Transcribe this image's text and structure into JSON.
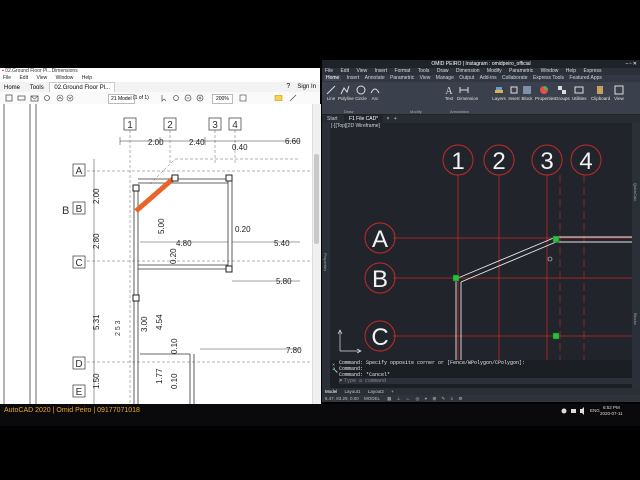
{
  "pdf": {
    "title": "02.Ground Floor Pl...Dimensions",
    "menu": [
      "File",
      "Edit",
      "View",
      "Window",
      "Help"
    ],
    "tabs": {
      "home": "Home",
      "tools": "Tools",
      "doc": "02.Ground Floor Pl..."
    },
    "sign_in": "Sign In",
    "page_field": "21 Model",
    "page_count": "(1 of 1)",
    "zoom": "200%",
    "axes": [
      "1",
      "2",
      "3",
      "4",
      "A",
      "B",
      "C",
      "D",
      "E"
    ],
    "dims": {
      "d200": "2.00",
      "d240": "2.40",
      "d040": "0.40",
      "d660": "6.60",
      "v200": "2.00",
      "v280": "2.80",
      "v531": "5.31",
      "v150": "1.50",
      "d500": "5.00",
      "d480": "4.80",
      "d020": "0.20",
      "d540": "5.40",
      "d580": "5.80",
      "d780": "7.80",
      "d300": "3.00",
      "d454": "4.54",
      "d010": "0.10",
      "d1770": "1.77",
      "d0100": "0.10",
      "d020b": "0.20"
    },
    "room_label": "2 5 3",
    "bay_mark": "B"
  },
  "cad": {
    "title": "OMID PEIRO | Instagram : omidpeiro_official",
    "menu": [
      "File",
      "Edit",
      "View",
      "Insert",
      "Format",
      "Tools",
      "Draw",
      "Dimension",
      "Modify",
      "Parametric",
      "Window",
      "Help",
      "Express"
    ],
    "ribbon_tabs": [
      "Home",
      "Insert",
      "Annotate",
      "Parametric",
      "View",
      "Manage",
      "Output",
      "Add-ins",
      "Collaborate",
      "Express Tools",
      "Featured Apps"
    ],
    "active_tab": "Home",
    "tools": {
      "line": "Line",
      "polyline": "Polyline",
      "circle": "Circle",
      "arc": "Arc",
      "text": "Text",
      "dimension": "Dimension",
      "layers": "Layers",
      "insert": "Insert",
      "block": "Block",
      "properties": "Properties",
      "groups": "Groups",
      "utilities": "Utilities",
      "clipboard": "Clipboard",
      "view": "View"
    },
    "panels": {
      "draw": "Draw",
      "modify": "Modify",
      "annotation": "Annotation"
    },
    "file_tabs": [
      "Start",
      "F1 File CAD*"
    ],
    "viewport_label": "[-][Top][2D Wireframe]",
    "axes": [
      "1",
      "2",
      "3",
      "4",
      "A",
      "B",
      "C"
    ],
    "side_left": "Properties",
    "side_right_top": "QuickCalc",
    "side_right_bottom": "Blocks",
    "command_lines": [
      "Command: Specify opposite corner or [Fence/WPolygon/CPolygon]:",
      "Command:",
      "Command: *Cancel*"
    ],
    "command_placeholder": "Type a command",
    "layout_tabs": [
      "Model",
      "Layout1",
      "Layout2"
    ],
    "status_coords": "6.47, 83.29, 0.00",
    "status_mode": "MODEL",
    "colors": {
      "axis": "#d82a2a",
      "grip": "#28c040",
      "line": "#e8e8e8"
    }
  },
  "taskbar": {
    "caption": "AutoCAD 2020 | Omid Peiro | 09177071018",
    "time": "6:52 PM",
    "date": "2020-07-11",
    "lang": "ENG"
  }
}
